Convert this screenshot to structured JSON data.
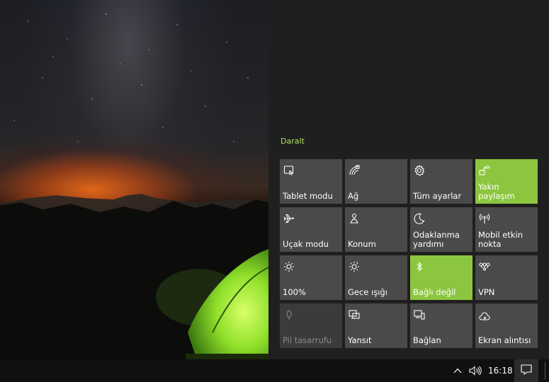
{
  "action_center": {
    "collapse_label": "Daralt",
    "accent_color": "#8cc63f",
    "tiles": [
      {
        "label": "Tablet modu",
        "icon": "tablet-mode-icon",
        "state": "off"
      },
      {
        "label": "Ağ",
        "icon": "network-icon",
        "state": "off"
      },
      {
        "label": "Tüm ayarlar",
        "icon": "gear-icon",
        "state": "off"
      },
      {
        "label": "Yakın paylaşım",
        "icon": "nearby-share-icon",
        "state": "on"
      },
      {
        "label": "Uçak modu",
        "icon": "airplane-icon",
        "state": "off"
      },
      {
        "label": "Konum",
        "icon": "location-icon",
        "state": "off"
      },
      {
        "label": "Odaklanma yardımı",
        "icon": "moon-icon",
        "state": "off"
      },
      {
        "label": "Mobil etkin nokta",
        "icon": "hotspot-icon",
        "state": "off"
      },
      {
        "label": "100%",
        "icon": "brightness-icon",
        "state": "off"
      },
      {
        "label": "Gece ışığı",
        "icon": "night-light-icon",
        "state": "off"
      },
      {
        "label": "Bağlı değil",
        "icon": "bluetooth-icon",
        "state": "on"
      },
      {
        "label": "VPN",
        "icon": "vpn-icon",
        "state": "off"
      },
      {
        "label": "Pil tasarrufu",
        "icon": "battery-saver-icon",
        "state": "disabled"
      },
      {
        "label": "Yansıt",
        "icon": "project-icon",
        "state": "off"
      },
      {
        "label": "Bağlan",
        "icon": "connect-icon",
        "state": "off"
      },
      {
        "label": "Ekran alıntısı",
        "icon": "screen-snip-icon",
        "state": "off"
      }
    ]
  },
  "taskbar": {
    "clock": "16:18",
    "tray_icons": [
      "chevron-up-icon",
      "volume-icon"
    ],
    "notification_icon": "notification-icon"
  }
}
